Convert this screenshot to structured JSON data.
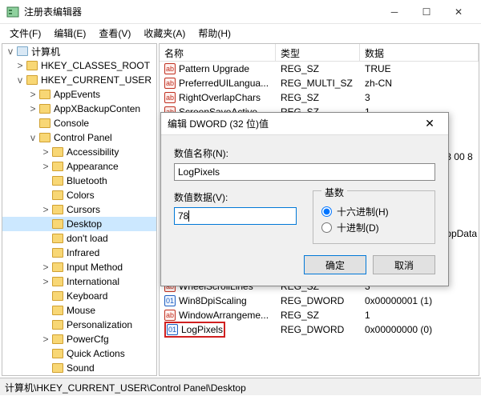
{
  "window": {
    "title": "注册表编辑器",
    "menus": [
      "文件(F)",
      "编辑(E)",
      "查看(V)",
      "收藏夹(A)",
      "帮助(H)"
    ]
  },
  "tree": {
    "root": "计算机",
    "nodes": [
      {
        "indent": 1,
        "exp": ">",
        "label": "HKEY_CLASSES_ROOT"
      },
      {
        "indent": 1,
        "exp": "v",
        "label": "HKEY_CURRENT_USER"
      },
      {
        "indent": 2,
        "exp": ">",
        "label": "AppEvents"
      },
      {
        "indent": 2,
        "exp": ">",
        "label": "AppXBackupConten"
      },
      {
        "indent": 2,
        "exp": "",
        "label": "Console"
      },
      {
        "indent": 2,
        "exp": "v",
        "label": "Control Panel"
      },
      {
        "indent": 3,
        "exp": ">",
        "label": "Accessibility"
      },
      {
        "indent": 3,
        "exp": ">",
        "label": "Appearance"
      },
      {
        "indent": 3,
        "exp": "",
        "label": "Bluetooth"
      },
      {
        "indent": 3,
        "exp": "",
        "label": "Colors"
      },
      {
        "indent": 3,
        "exp": ">",
        "label": "Cursors"
      },
      {
        "indent": 3,
        "exp": "",
        "label": "Desktop",
        "selected": true
      },
      {
        "indent": 3,
        "exp": "",
        "label": "don't load"
      },
      {
        "indent": 3,
        "exp": "",
        "label": "Infrared"
      },
      {
        "indent": 3,
        "exp": ">",
        "label": "Input Method"
      },
      {
        "indent": 3,
        "exp": ">",
        "label": "International"
      },
      {
        "indent": 3,
        "exp": "",
        "label": "Keyboard"
      },
      {
        "indent": 3,
        "exp": "",
        "label": "Mouse"
      },
      {
        "indent": 3,
        "exp": "",
        "label": "Personalization"
      },
      {
        "indent": 3,
        "exp": ">",
        "label": "PowerCfg"
      },
      {
        "indent": 3,
        "exp": "",
        "label": "Quick Actions"
      },
      {
        "indent": 3,
        "exp": "",
        "label": "Sound"
      }
    ]
  },
  "list": {
    "headers": {
      "name": "名称",
      "type": "类型",
      "data": "数据"
    },
    "rows_top": [
      {
        "icon": "sz",
        "name": "Pattern Upgrade",
        "type": "REG_SZ",
        "data": "TRUE"
      },
      {
        "icon": "sz",
        "name": "PreferredUILangua...",
        "type": "REG_MULTI_SZ",
        "data": "zh-CN"
      },
      {
        "icon": "sz",
        "name": "RightOverlapChars",
        "type": "REG_SZ",
        "data": "3"
      },
      {
        "icon": "sz",
        "name": "ScreenSaveActive",
        "type": "REG_SZ",
        "data": "1"
      }
    ],
    "peek": [
      {
        "text": "3 00 8"
      },
      {
        "text": ""
      },
      {
        "text": ""
      },
      {
        "text": "ppData"
      }
    ],
    "rows_bottom": [
      {
        "icon": "sz",
        "name": "WheelScrollLines",
        "type": "REG_SZ",
        "data": "3"
      },
      {
        "icon": "dw",
        "name": "Win8DpiScaling",
        "type": "REG_DWORD",
        "data": "0x00000001 (1)"
      },
      {
        "icon": "sz",
        "name": "WindowArrangeme...",
        "type": "REG_SZ",
        "data": "1"
      },
      {
        "icon": "dw",
        "name": "LogPixels",
        "type": "REG_DWORD",
        "data": "0x00000000 (0)",
        "hl": true
      }
    ]
  },
  "dialog": {
    "title": "编辑 DWORD (32 位)值",
    "name_label": "数值名称(N):",
    "name_value": "LogPixels",
    "data_label": "数值数据(V):",
    "data_value": "78",
    "radix_label": "基数",
    "radix_hex": "十六进制(H)",
    "radix_dec": "十进制(D)",
    "ok": "确定",
    "cancel": "取消"
  },
  "statusbar": "计算机\\HKEY_CURRENT_USER\\Control Panel\\Desktop"
}
